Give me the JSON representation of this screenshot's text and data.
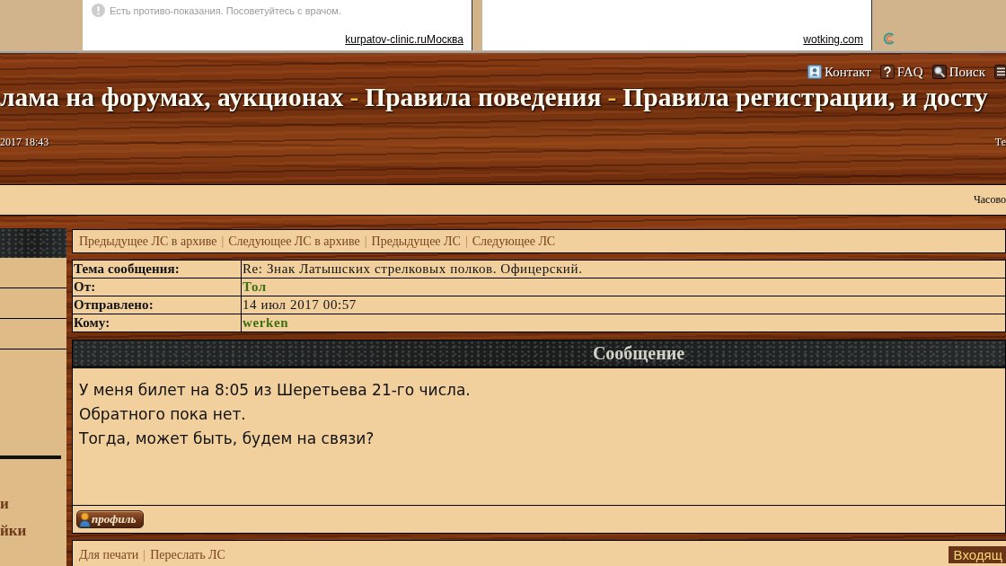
{
  "ads": [
    {
      "notice": "Есть противо-показания. Посоветуйтесь с врачом.",
      "link": "kurpatov-clinic.ruМосква"
    },
    {
      "link": "wotking.com"
    }
  ],
  "header": {
    "links": [
      {
        "kind": "contact",
        "label": "Контакт"
      },
      {
        "kind": "faq",
        "label": "FAQ"
      },
      {
        "kind": "search",
        "label": "Поиск"
      },
      {
        "kind": "list"
      }
    ],
    "title": [
      {
        "kind": "link",
        "text": "лама на форумах, аукционах"
      },
      {
        "kind": "separator",
        "text": "-"
      },
      {
        "kind": "link",
        "text": "Правила поведения"
      },
      {
        "kind": "separator",
        "text": "-"
      },
      {
        "kind": "link",
        "text": "Правила регистрации, и досту"
      }
    ],
    "time": "2017 18:43",
    "right_text": "Те"
  },
  "info_bar": {
    "text": "Часово"
  },
  "sidebar": {
    "links": [
      "и",
      "йки"
    ]
  },
  "nav": [
    {
      "kind": "link",
      "text": "Предыдущее ЛС в архиве"
    },
    {
      "kind": "separator",
      "text": "|"
    },
    {
      "kind": "link",
      "text": "Следующее ЛС в архиве"
    },
    {
      "kind": "separator",
      "text": "|"
    },
    {
      "kind": "link",
      "text": "Предыдущее ЛС"
    },
    {
      "kind": "separator",
      "text": "|"
    },
    {
      "kind": "link",
      "text": "Следующее ЛС"
    }
  ],
  "message": {
    "fields": [
      {
        "kind": "text",
        "label": "Тема сообщения:",
        "value": "Re: Знак Латышских стрелковых полков. Офицерский."
      },
      {
        "kind": "user",
        "label": "От:",
        "value": "Тол"
      },
      {
        "kind": "text",
        "label": "Отправлено:",
        "value": "14 июл 2017 00:57"
      },
      {
        "kind": "user",
        "label": "Кому:",
        "value": "werken"
      }
    ],
    "heading": "Сообщение",
    "body": [
      "У меня билет на 8:05 из Шеретьева 21-го числа.",
      "Обратного пока нет.",
      "Тогда, может быть, будем на связи?"
    ],
    "profile_button": "профиль"
  },
  "footer": {
    "links": [
      {
        "kind": "link",
        "text": "Для печати"
      },
      {
        "kind": "separator",
        "text": "|"
      },
      {
        "kind": "link",
        "text": "Переслать ЛС"
      }
    ],
    "folder_button": "Входящ"
  }
}
